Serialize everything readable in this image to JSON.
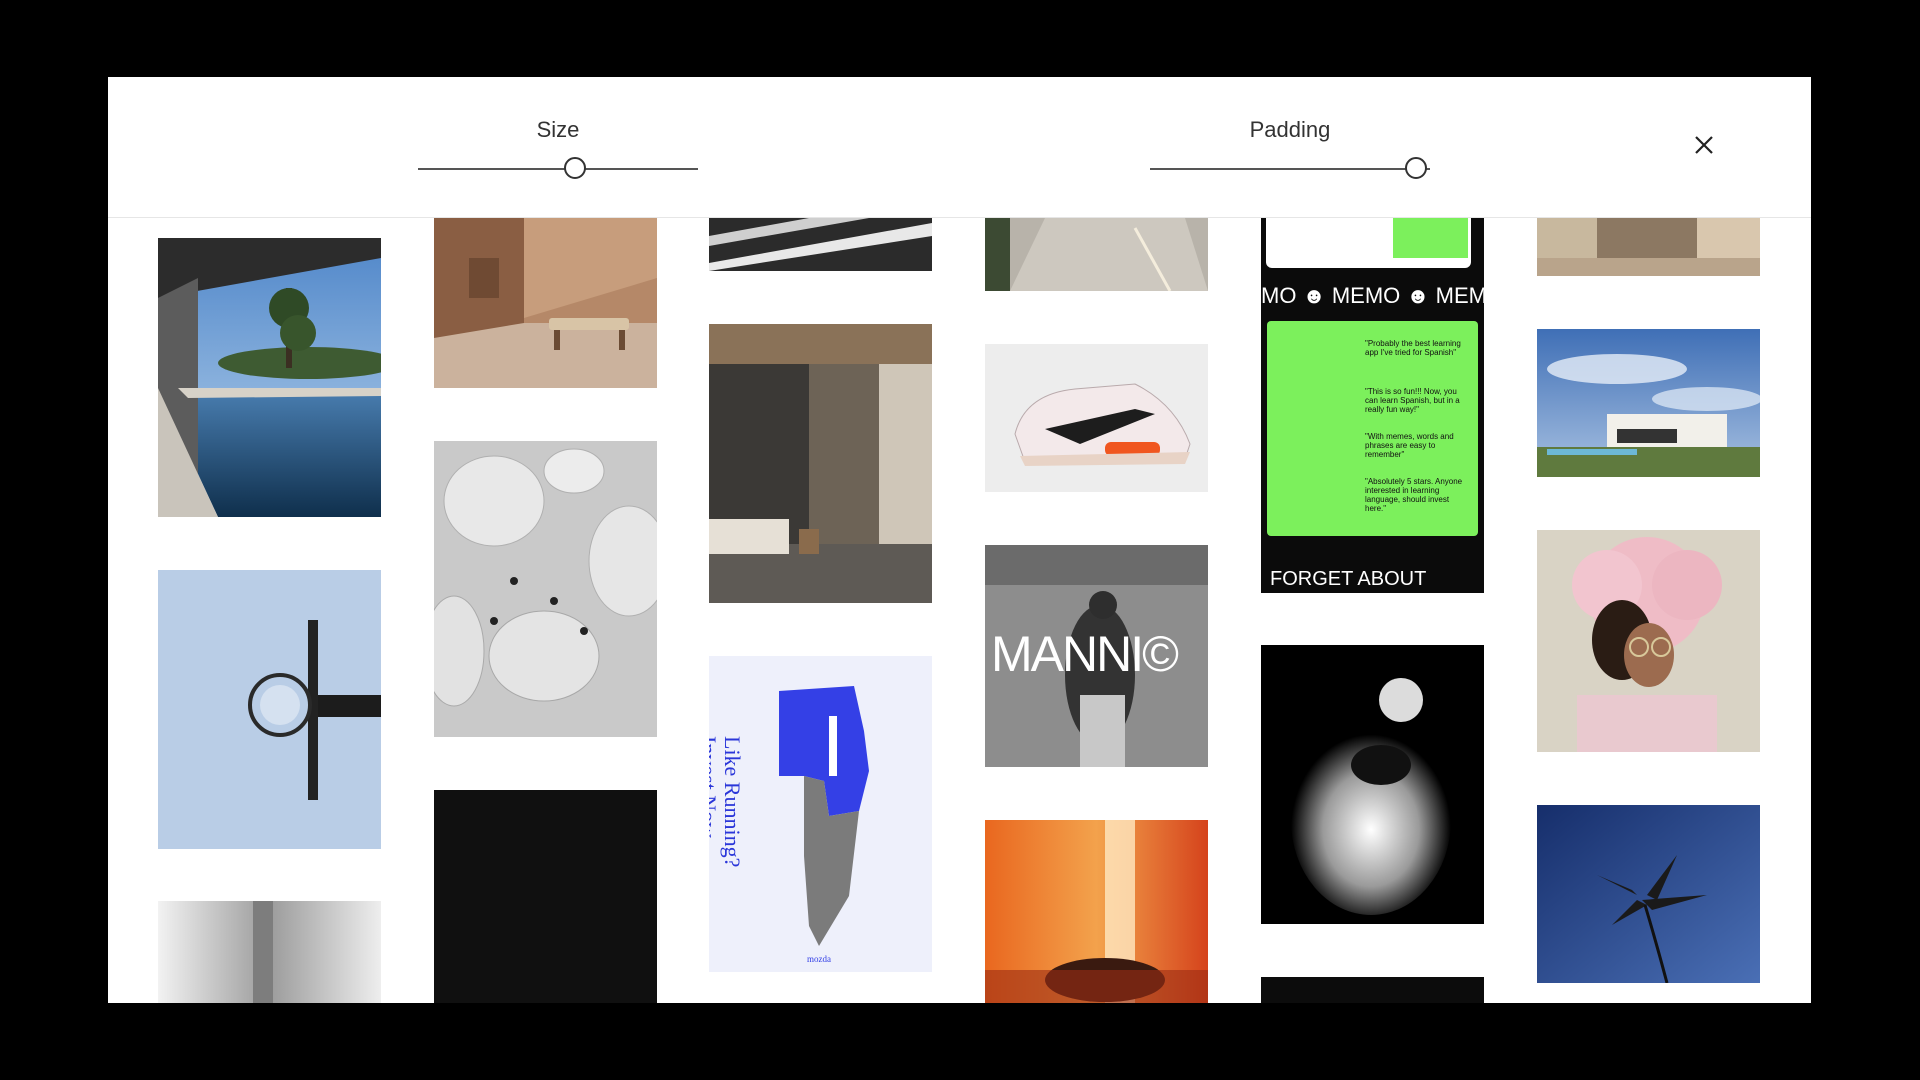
{
  "controls": {
    "size": {
      "label": "Size",
      "value": 0.56
    },
    "padding": {
      "label": "Padding",
      "value": 0.95
    },
    "close_icon": "close-icon"
  },
  "gallery": {
    "tiles": [
      {
        "id": "infinity-pool"
      },
      {
        "id": "basketball-hoop"
      },
      {
        "id": "grey-garment"
      },
      {
        "id": "concrete-room-lounger"
      },
      {
        "id": "water-drops"
      },
      {
        "id": "black-tile"
      },
      {
        "id": "road-stripes"
      },
      {
        "id": "minimal-bedroom"
      },
      {
        "id": "running-poster",
        "text": {
          "headline1": "Like Running?",
          "headline2": "Invest Now.",
          "brand": "mozda"
        }
      },
      {
        "id": "lit-corridor"
      },
      {
        "id": "sneaker"
      },
      {
        "id": "mannic-poster",
        "text": {
          "title": "MANNI©"
        }
      },
      {
        "id": "orange-portrait"
      },
      {
        "id": "memo-app",
        "text": {
          "ticker": "MO ☻ MEMO ☻ MEM",
          "quote1": "\"Probably the best learning app I've tried for Spanish\"",
          "quote2": "\"This is so fun!!! Now, you can learn Spanish, but in a really fun way!\"",
          "quote3": "\"With memes, words and phrases are easy to remember\"",
          "quote4": "\"Absolutely 5 stars. Anyone interested in learning language, should invest here.\"",
          "footer": "FORGET ABOUT"
        }
      },
      {
        "id": "glow-figure"
      },
      {
        "id": "dark-tile"
      },
      {
        "id": "glass-interior"
      },
      {
        "id": "modern-villa"
      },
      {
        "id": "pink-hair-portrait"
      },
      {
        "id": "lily-flower"
      }
    ]
  }
}
